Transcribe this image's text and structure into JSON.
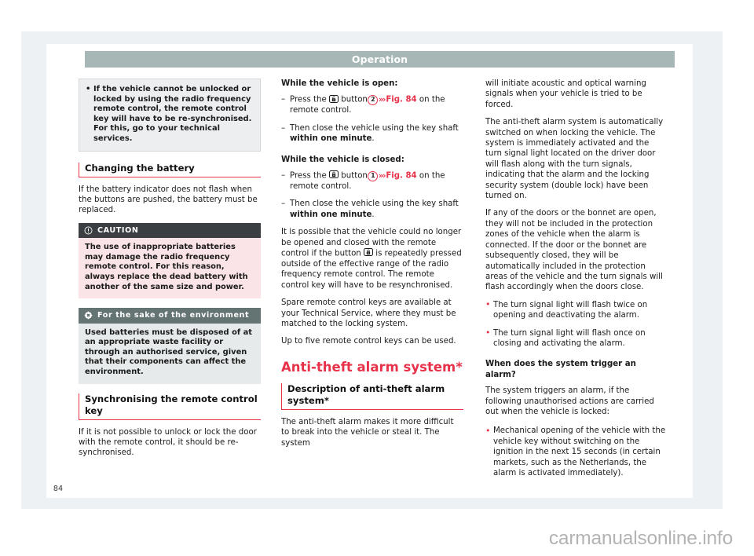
{
  "header": {
    "title": "Operation"
  },
  "page_number": "84",
  "watermark": "carmanualsonline.info",
  "colors": {
    "accent_red": "#e8324a",
    "header_band": "#a7b7b5",
    "caution_header": "#3b3f41",
    "caution_body": "#fbe4e8",
    "env_header": "#647472",
    "env_body": "#e7eaea",
    "note_box": "#eceeef"
  },
  "left_column": {
    "note": {
      "text": "If the vehicle cannot be unlocked or locked by using the radio frequency remote control, the remote control key will have to be re-synchronised. For this, go to your technical services."
    },
    "heading_battery": "Changing the battery",
    "battery_intro": "If the battery indicator does not flash when the buttons are pushed, the battery must be replaced.",
    "caution": {
      "icon": "exclamation-circle-icon",
      "label": "CAUTION",
      "text": "The use of inappropriate batteries may damage the radio frequency remote control. For this reason, always replace the dead battery with another of the same size and power."
    },
    "environment": {
      "icon": "flower-environment-icon",
      "label": "For the sake of the environment",
      "text": "Used batteries must be disposed of at an appropriate waste facility or through an authorised service, given that their components can affect the environment."
    },
    "heading_sync": "Synchronising the remote control key",
    "sync_text": "If it is not possible to unlock or lock the door with the remote control, it should be re-synchronised."
  },
  "mid_column": {
    "subhead_open": "While the vehicle is open:",
    "open_step1": {
      "pre": "Press the",
      "icon": "unlock-button-icon",
      "mid": "button",
      "number": "2",
      "arrow": "»›",
      "fig": "Fig. 84",
      "post": "on the remote control."
    },
    "open_step2": {
      "pre": "Then close the vehicle using the key shaft",
      "bold": "within one minute",
      "post": "."
    },
    "subhead_closed": "While the vehicle is closed:",
    "closed_step1": {
      "pre": "Press the",
      "icon": "lock-button-icon",
      "mid": "button",
      "number": "1",
      "arrow": "»›",
      "fig": "Fig. 84",
      "post": "on the remote control."
    },
    "closed_step2": {
      "pre": "Then close the vehicle using the key shaft",
      "bold": "within one minute",
      "post": "."
    },
    "para_repeat": {
      "pre": "It is possible that the vehicle could no longer be opened and closed with the remote control if the button",
      "icon": "lock-button-icon",
      "post": "is repeatedly pressed outside of the effective range of the radio frequency remote control. The remote control key will have to be resynchronised."
    },
    "para_spare": "Spare remote control keys are available at your Technical Service, where they must be matched to the locking system.",
    "para_five": "Up to five remote control keys can be used.",
    "chapter_heading": "Anti-theft alarm system*",
    "section_heading": "Description of anti-theft alarm system*",
    "description_start": "The anti-theft alarm makes it more difficult to break into the vehicle or steal it. The system"
  },
  "right_column": {
    "description_cont": "will initiate acoustic and optical warning signals when your vehicle is tried to be forced.",
    "para_auto": "The anti-theft alarm system is automatically switched on when locking the vehicle. The system is immediately activated and the turn signal light located on the driver door will flash along with the turn signals, indicating that the alarm and the locking security system (double lock) have been turned on.",
    "para_doors": "If any of the doors or the bonnet are open, they will not be included in the protection zones of the vehicle when the alarm is connected. If the door or the bonnet are subsequently closed, they will be automatically included in the protection areas of the vehicle and the turn signals will flash accordingly when the doors close.",
    "bullets": [
      "The turn signal light will flash twice on opening and deactivating the alarm.",
      "The turn signal light will flash once on closing and activating the alarm."
    ],
    "subhead_trigger": "When does the system trigger an alarm?",
    "para_trigger": "The system triggers an alarm, if the following unauthorised actions are carried out when the vehicle is locked:",
    "trigger_bullets": [
      "Mechanical opening of the vehicle with the vehicle key without switching on the ignition in the next 15 seconds (in certain markets, such as the Netherlands, the alarm is activated immediately)."
    ]
  }
}
